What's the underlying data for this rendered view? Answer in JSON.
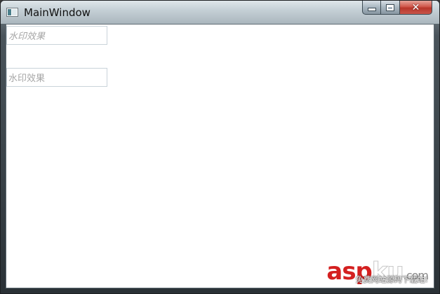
{
  "window": {
    "title": "MainWindow",
    "icon": "wpf-window-icon"
  },
  "title_controls": {
    "minimize_icon": "minimize-icon",
    "maximize_icon": "maximize-icon",
    "close_icon": "close-icon"
  },
  "textboxes": [
    {
      "placeholder": "水印效果",
      "style": "italic"
    },
    {
      "placeholder": "水印效果",
      "style": "normal"
    }
  ],
  "site_watermark": {
    "brand_red": "asp",
    "brand_white": "ku",
    "brand_suffix": ".com",
    "tagline": "免费网站源码下载站!",
    "red_color": "#d42020"
  }
}
